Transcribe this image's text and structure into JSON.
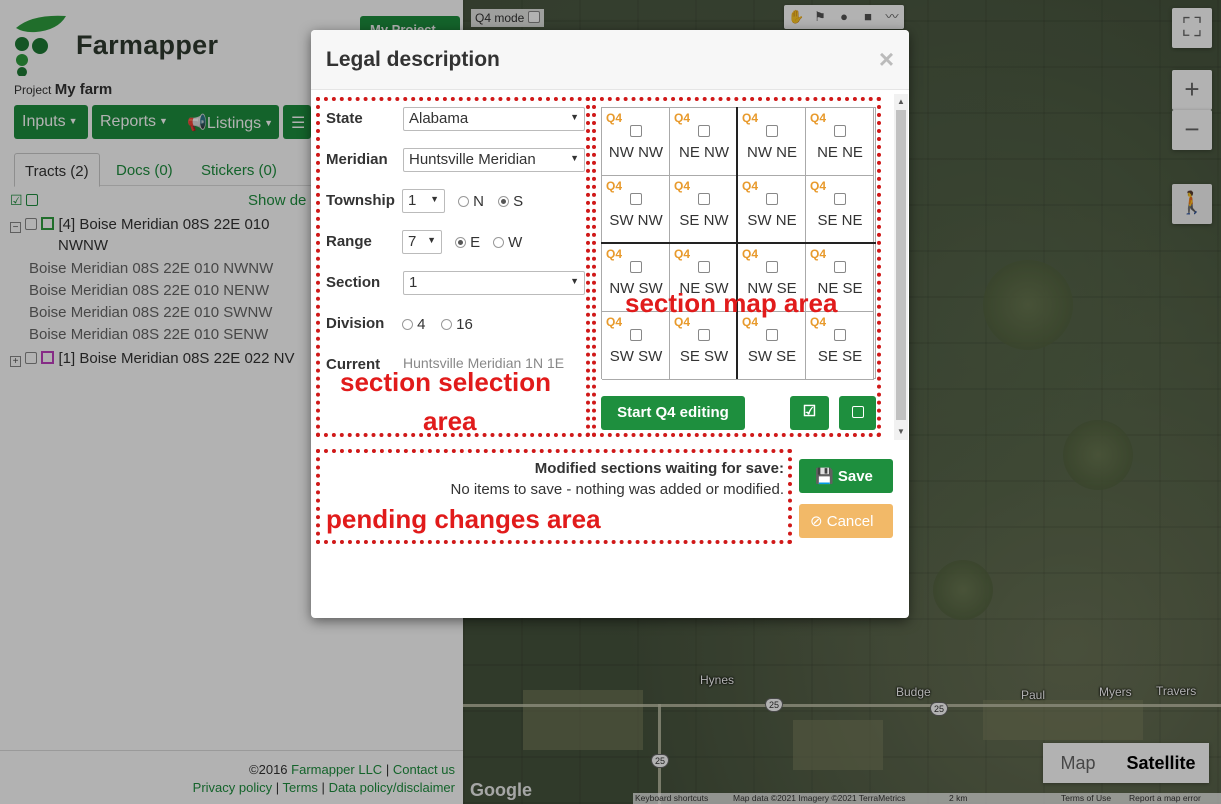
{
  "brand": {
    "name": "Farmapper",
    "project_label": "Project",
    "project_name": "My farm",
    "my_project_btn": "My Project"
  },
  "toolbar": {
    "inputs": "Inputs",
    "reports": "Reports",
    "listings": "Listings"
  },
  "tabs": [
    {
      "label": "Tracts (2)"
    },
    {
      "label": "Docs  (0)"
    },
    {
      "label": "Stickers  (0)"
    }
  ],
  "tree": {
    "show_details": "Show de",
    "node1": {
      "title_l1": "[4] Boise Meridian 08S 22E 010",
      "title_l2": "NWNW",
      "color": "#2e9e3e"
    },
    "children": [
      "Boise Meridian 08S 22E 010 NWNW",
      "Boise Meridian 08S 22E 010 NENW",
      "Boise Meridian 08S 22E 010 SWNW",
      "Boise Meridian 08S 22E 010 SENW"
    ],
    "node2": {
      "title": "[1] Boise Meridian 08S 22E 022 NV",
      "color": "#c040c0"
    }
  },
  "footer": {
    "copy_prefix": "©2016",
    "company": "Farmapper LLC",
    "contact": "Contact us",
    "privacy": "Privacy policy",
    "terms": "Terms",
    "data_policy": "Data policy/disclaimer",
    "sep": "|"
  },
  "map": {
    "q4_mode": "Q4 mode",
    "places": [
      "Hynes",
      "Budge",
      "Paul",
      "Myers",
      "Travers"
    ],
    "highway": "25",
    "map_type": {
      "map": "Map",
      "satellite": "Satellite"
    },
    "google": "Google",
    "attribution": {
      "shortcuts": "Keyboard shortcuts",
      "data": "Map data ©2021 Imagery ©2021 TerraMetrics",
      "scale": "2 km",
      "terms": "Terms of Use",
      "report": "Report a map error"
    }
  },
  "modal": {
    "title": "Legal description",
    "close": "×",
    "labels": {
      "state": "State",
      "meridian": "Meridian",
      "township": "Township",
      "range": "Range",
      "section": "Section",
      "division": "Division",
      "current": "Current"
    },
    "values": {
      "state": "Alabama",
      "meridian": "Huntsville Meridian",
      "township": "1",
      "range": "7",
      "section": "1",
      "current": "Huntsville Meridian 1N 1E"
    },
    "township_dirs": [
      "N",
      "S"
    ],
    "range_dirs": [
      "E",
      "W"
    ],
    "divisions": [
      "4",
      "16"
    ],
    "grid": {
      "q4_label": "Q4",
      "cells": [
        "NW NW",
        "NE NW",
        "NW NE",
        "NE NE",
        "SW NW",
        "SE NW",
        "SW NE",
        "SE NE",
        "NW SW",
        "NE SW",
        "NW SE",
        "NE SE",
        "SW SW",
        "SE SW",
        "SW SE",
        "SE SE"
      ]
    },
    "start_q4": "Start Q4 editing",
    "pending": {
      "title": "Modified sections waiting for save:",
      "message": "No items to save - nothing was added or modified."
    },
    "save": "Save",
    "cancel": "Cancel"
  },
  "annotations": {
    "selection": [
      "section selection",
      "area"
    ],
    "map": "section map area",
    "pending": "pending changes area"
  }
}
